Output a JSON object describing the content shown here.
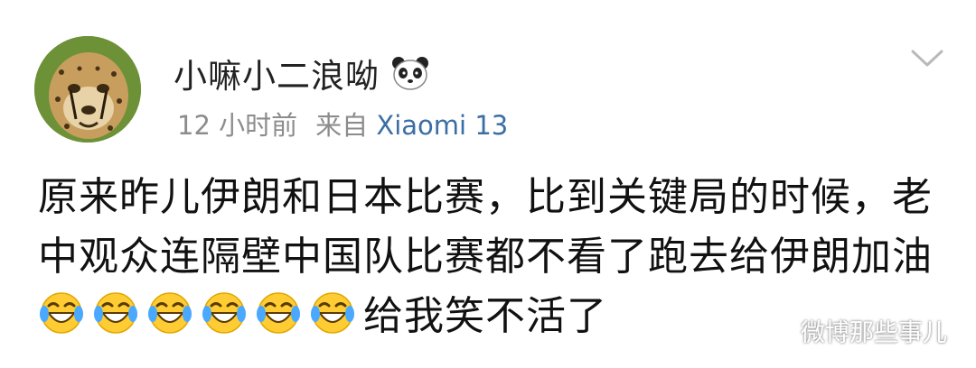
{
  "post": {
    "username": "小嘛小二浪呦",
    "time": "12 小时前",
    "source_prefix": "来自",
    "device": "Xiaomi 13",
    "text_part1": "原来昨儿伊朗和日本比赛，比到关键局的时候，老中观众连隔壁中国队比赛都不看了跑去给伊朗加油",
    "emoji_count": 6,
    "text_part2": "给我笑不活了"
  },
  "icons": {
    "name_badge": "panda-icon",
    "menu": "chevron-down-icon",
    "emoji": "laughing-with-tears-emoji",
    "watermark": "wechat-icon"
  },
  "watermark": {
    "text": "微博那些事儿"
  },
  "colors": {
    "device_link": "#3a6ea5",
    "meta_gray": "#8c8c8c",
    "text": "#111111"
  }
}
